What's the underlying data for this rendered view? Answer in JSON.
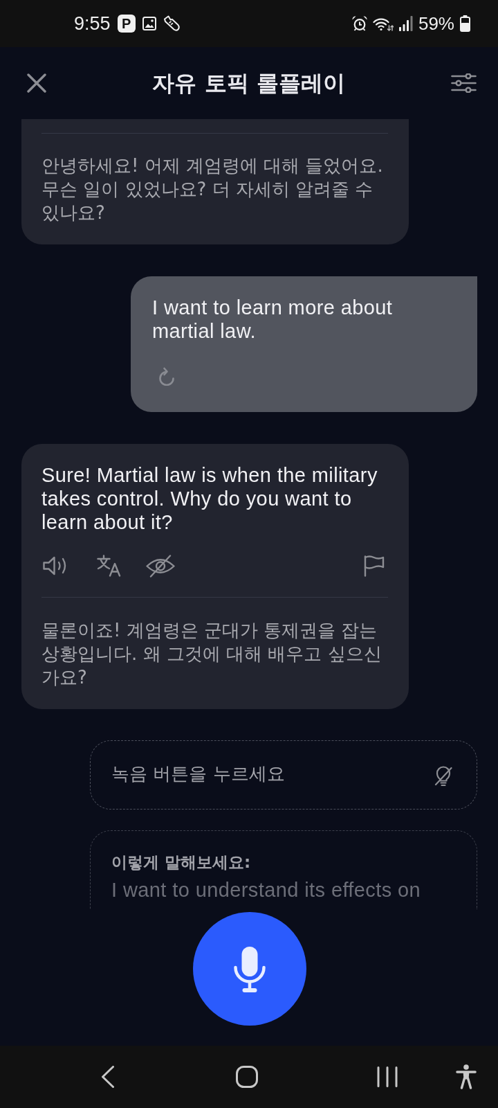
{
  "status_bar": {
    "time": "9:55",
    "app_badge": "P",
    "battery": "59%"
  },
  "header": {
    "title": "자유 토픽 롤플레이"
  },
  "messages": [
    {
      "kind": "assistant",
      "translation": "안녕하세요! 어제 계엄령에 대해 들었어요. 무슨 일이 있었나요? 더 자세히 알려줄 수 있나요?"
    },
    {
      "kind": "user",
      "text": "I want to learn more about martial law."
    },
    {
      "kind": "assistant",
      "text": "Sure! Martial law is when the military takes control. Why do you want to learn about it?",
      "translation": "물론이죠! 계엄령은 군대가 통제권을 잡는 상황입니다. 왜 그것에 대해 배우고 싶으신가요?"
    }
  ],
  "transcript": {
    "prompt": "녹음 버튼을 누르세요"
  },
  "suggestion": {
    "label": "이렇게 말해보세요:",
    "text": "I want to understand its effects on"
  }
}
